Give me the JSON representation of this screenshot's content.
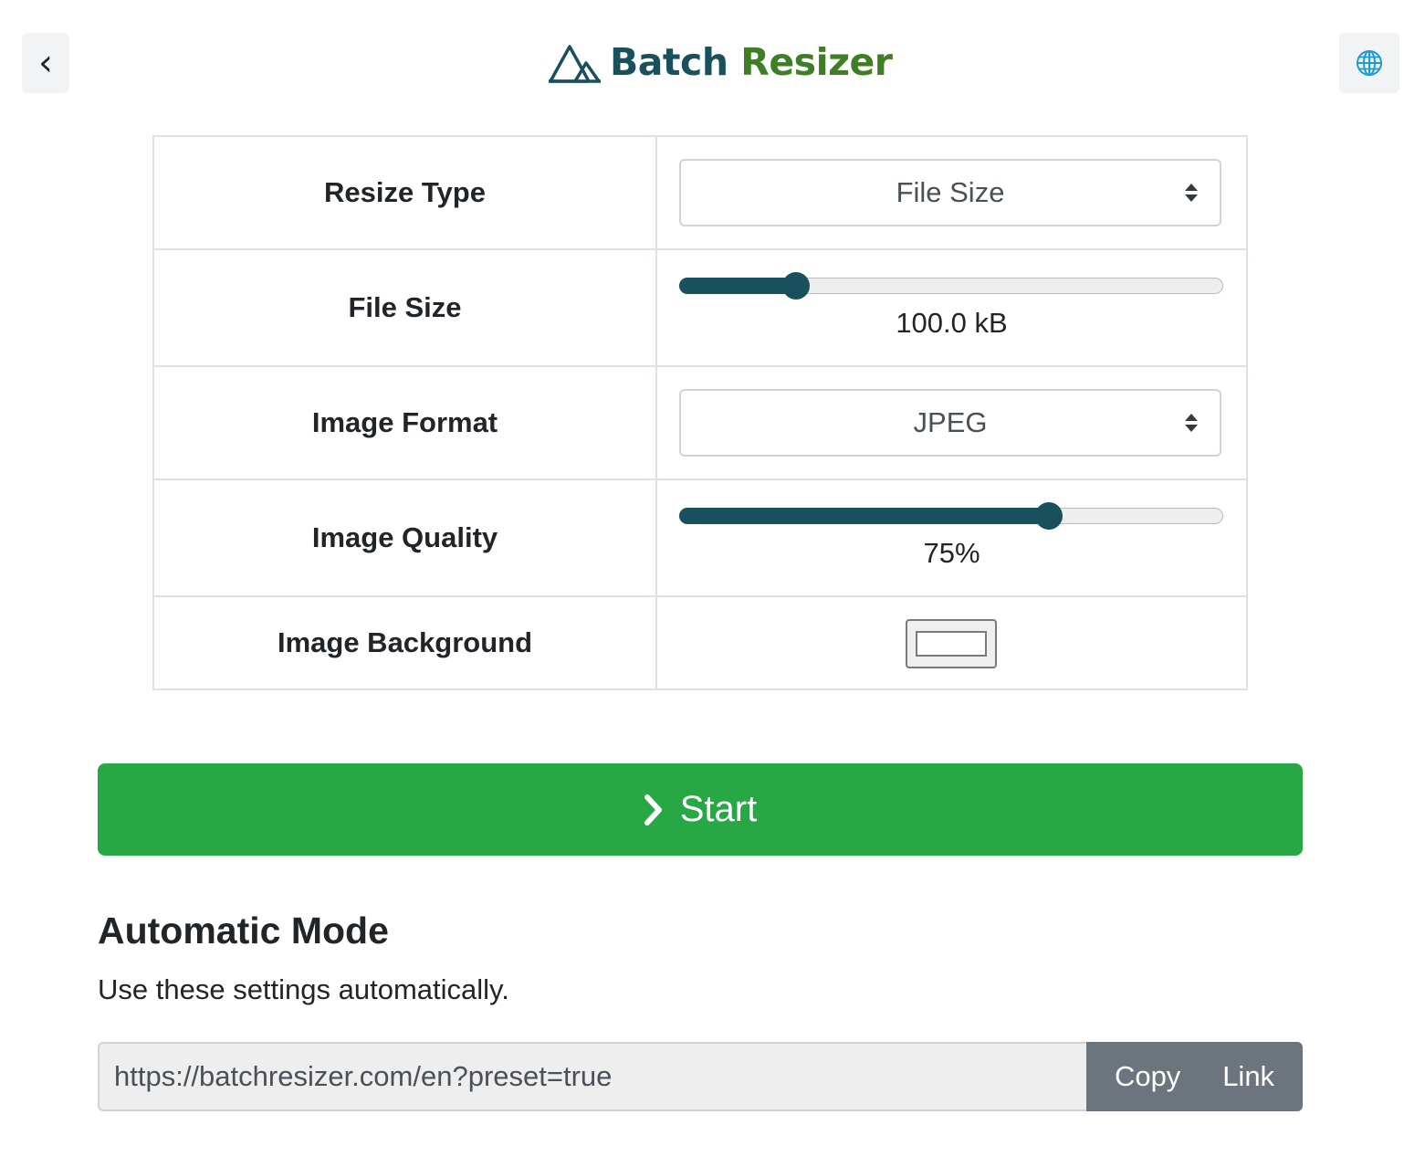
{
  "header": {
    "back_icon": "chevron-left-icon",
    "back_glyph": "‹",
    "logo_icon": "mountain-icon",
    "brand_part1": "Batch",
    "brand_part2": "Resizer",
    "language_icon": "globe-icon",
    "colors": {
      "brand_dark": "#18505e",
      "brand_green": "#3e7e24"
    }
  },
  "settings": {
    "resize_type": {
      "label": "Resize Type",
      "selected": "File Size"
    },
    "file_size": {
      "label": "File Size",
      "value_text": "100.0 kB",
      "level": 0.215
    },
    "image_format": {
      "label": "Image Format",
      "selected": "JPEG"
    },
    "image_quality": {
      "label": "Image Quality",
      "value_text": "75%",
      "level": 0.68
    },
    "image_background": {
      "label": "Image Background",
      "color": "#ffffff"
    }
  },
  "start": {
    "label": "Start",
    "icon": "chevron-right-icon",
    "color": "#28a745"
  },
  "automatic_mode": {
    "title": "Automatic Mode",
    "description": "Use these settings automatically.",
    "link_value": "https://batchresizer.com/en?preset=true",
    "copy_label": "Copy",
    "link_label": "Link"
  }
}
